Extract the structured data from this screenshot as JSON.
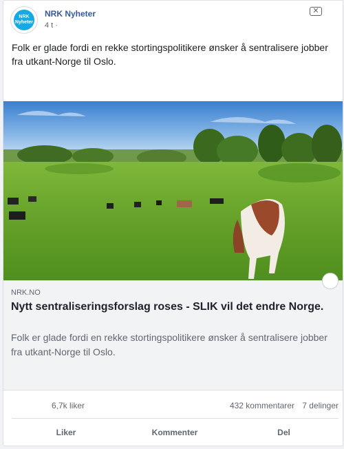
{
  "post": {
    "page_name": "NRK Nyheter",
    "avatar_text_top": "NRK",
    "avatar_text_bottom": "Nyheter",
    "timestamp": "4 t ·",
    "text": "Folk er glade fordi en rekke stortingspolitikere ønsker å sentralisere jobber fra utkant-Norge til Oslo.",
    "close_icon": "close-icon"
  },
  "link": {
    "source": "NRK.NO",
    "title": "Nytt sentraliseringsforslag roses - SLIK vil det endre Norge.",
    "description": "Folk er glade fordi en rekke stortingspolitikere ønsker å sentralisere jobber fra utkant-Norge til Oslo."
  },
  "stats": {
    "likes": "6,7k liker",
    "comments": "432 kommentarer",
    "shares": "7 delinger"
  },
  "actions": {
    "like": "Liker",
    "comment": "Kommenter",
    "share": "Del"
  },
  "colors": {
    "link_blue": "#385898",
    "nrk_brand": "#18a8e4",
    "muted_text": "#606770"
  }
}
